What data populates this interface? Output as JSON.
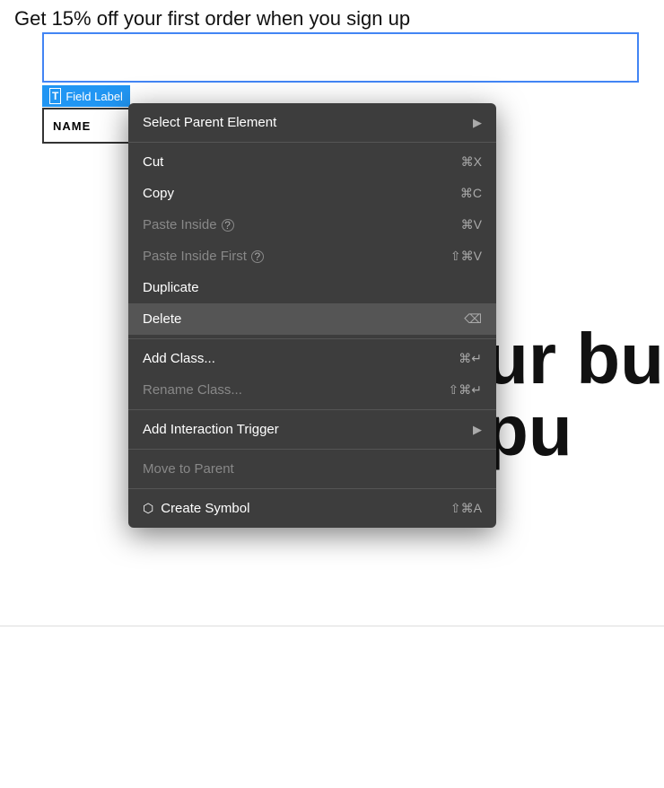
{
  "page": {
    "promo_text": "Get 15% off your first order when you sign up",
    "big_text_line1": "ur bu",
    "big_text_line2": "pu"
  },
  "field_label": {
    "badge_text": "Field Label",
    "name_placeholder": "NAME"
  },
  "context_menu": {
    "items": [
      {
        "id": "select-parent",
        "label": "Select Parent Element",
        "shortcut": "",
        "has_arrow": true,
        "disabled": false,
        "highlighted": false
      },
      {
        "id": "separator-1",
        "type": "separator"
      },
      {
        "id": "cut",
        "label": "Cut",
        "shortcut": "⌘X",
        "has_arrow": false,
        "disabled": false,
        "highlighted": false
      },
      {
        "id": "copy",
        "label": "Copy",
        "shortcut": "⌘C",
        "has_arrow": false,
        "disabled": false,
        "highlighted": false
      },
      {
        "id": "paste-inside",
        "label": "Paste Inside",
        "shortcut": "⌘V",
        "has_arrow": false,
        "disabled": true,
        "highlighted": false,
        "has_help": true
      },
      {
        "id": "paste-inside-first",
        "label": "Paste Inside First",
        "shortcut": "⇧⌘V",
        "has_arrow": false,
        "disabled": true,
        "highlighted": false,
        "has_help": true
      },
      {
        "id": "duplicate",
        "label": "Duplicate",
        "shortcut": "",
        "has_arrow": false,
        "disabled": false,
        "highlighted": false
      },
      {
        "id": "delete",
        "label": "Delete",
        "shortcut": "⌫",
        "has_arrow": false,
        "disabled": false,
        "highlighted": true
      },
      {
        "id": "separator-2",
        "type": "separator"
      },
      {
        "id": "add-class",
        "label": "Add Class...",
        "shortcut": "⌘↵",
        "has_arrow": false,
        "disabled": false,
        "highlighted": false
      },
      {
        "id": "rename-class",
        "label": "Rename Class...",
        "shortcut": "⇧⌘↵",
        "has_arrow": false,
        "disabled": true,
        "highlighted": false
      },
      {
        "id": "separator-3",
        "type": "separator"
      },
      {
        "id": "add-interaction",
        "label": "Add Interaction Trigger",
        "shortcut": "",
        "has_arrow": true,
        "disabled": false,
        "highlighted": false
      },
      {
        "id": "separator-4",
        "type": "separator"
      },
      {
        "id": "move-to-parent",
        "label": "Move to Parent",
        "shortcut": "",
        "has_arrow": false,
        "disabled": true,
        "highlighted": false
      },
      {
        "id": "separator-5",
        "type": "separator"
      },
      {
        "id": "create-symbol",
        "label": "Create Symbol",
        "shortcut": "⇧⌘A",
        "has_arrow": false,
        "disabled": false,
        "highlighted": false,
        "has_icon": true
      }
    ]
  }
}
